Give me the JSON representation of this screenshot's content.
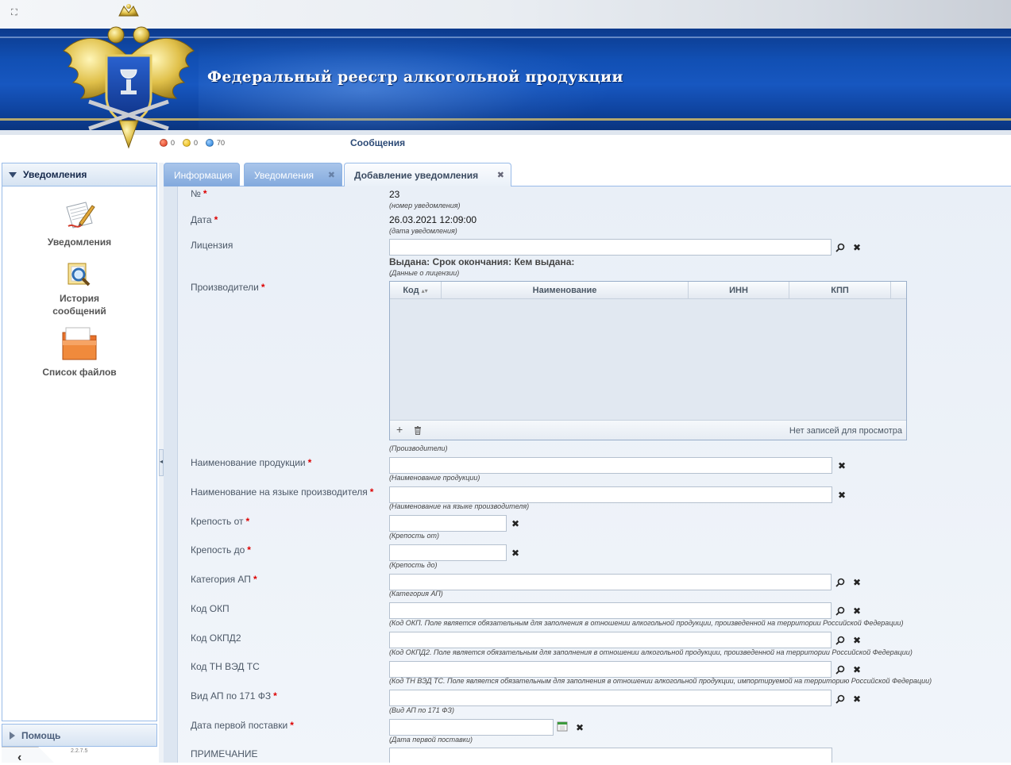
{
  "header": {
    "title": "Федеральный реестр алкогольной продукции",
    "expand_icon": "expand-icon",
    "messages": {
      "label": "Сообщения",
      "red_count": "0",
      "yellow_count": "0",
      "blue_count": "70",
      "colors": {
        "red": "#e0341a",
        "yellow": "#e8b400",
        "blue": "#1a78d6"
      }
    }
  },
  "sidebar": {
    "title": "Уведомления",
    "items": [
      {
        "label": "Уведомления",
        "icon": "notifications-document-icon"
      },
      {
        "label": "История сообщений",
        "icon": "message-history-icon"
      },
      {
        "label": "Список файлов",
        "icon": "folder-icon"
      }
    ],
    "help_label": "Помощь",
    "version": "2.2.7.5"
  },
  "tabs": [
    {
      "label": "Информация",
      "active": false,
      "closable": false
    },
    {
      "label": "Уведомления",
      "active": false,
      "closable": true
    },
    {
      "label": "Добавление уведомления",
      "active": true,
      "closable": true
    }
  ],
  "form": {
    "number": {
      "label": "№",
      "value": "23",
      "hint": "(номер уведомления)"
    },
    "date": {
      "label": "Дата",
      "value": "26.03.2021 12:09:00",
      "hint": "(дата уведомления)"
    },
    "license": {
      "label": "Лицензия",
      "value": "",
      "info": "Выдана: Срок окончания: Кем выдана:",
      "hint": "(Данные о лицензии)"
    },
    "producers": {
      "label": "Производители",
      "columns": [
        "Код",
        "Наименование",
        "ИНН",
        "КПП"
      ],
      "rows": [],
      "empty_text": "Нет записей для просмотра",
      "hint": "(Производители)"
    },
    "product_name": {
      "label": "Наименование продукции",
      "value": "",
      "hint": "(Наименование продукции)"
    },
    "product_name_native": {
      "label": "Наименование на языке производителя",
      "value": "",
      "hint": "(Наименование на языке производителя)"
    },
    "strength_from": {
      "label": "Крепость от",
      "value": "",
      "hint": "(Крепость от)"
    },
    "strength_to": {
      "label": "Крепость до",
      "value": "",
      "hint": "(Крепость до)"
    },
    "category": {
      "label": "Категория АП",
      "value": "",
      "hint": "(Категория АП)"
    },
    "okp": {
      "label": "Код ОКП",
      "value": "",
      "hint": "(Код ОКП. Поле является обязательным для заполнения в отношении алкогольной продукции, произведенной на территории Российской Федерации)"
    },
    "okpd2": {
      "label": "Код ОКПД2",
      "value": "",
      "hint": "(Код ОКПД2. Поле является обязательным для заполнения в отношении алкогольной продукции, произведенной на территории Российской Федерации)"
    },
    "tnved": {
      "label": "Код ТН ВЭД ТС",
      "value": "",
      "hint": "(Код ТН ВЭД ТС. Поле является обязательным для заполнения в отношении алкогольной продукции, импортируемой на территорию Российской Федерации)"
    },
    "ap_type": {
      "label": "Вид АП по 171 ФЗ",
      "value": "",
      "hint": "(Вид АП по 171 ФЗ)"
    },
    "first_delivery": {
      "label": "Дата первой поставки",
      "value": "",
      "hint": "(Дата первой поставки)"
    },
    "note": {
      "label": "ПРИМЕЧАНИЕ",
      "value": ""
    }
  }
}
